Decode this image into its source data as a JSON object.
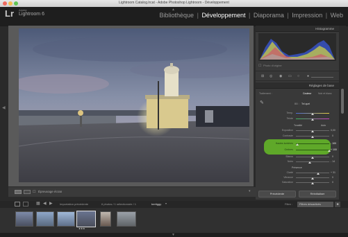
{
  "window": {
    "title": "Lightroom Catalog.lrcat - Adobe Photoshop Lightroom - Développement"
  },
  "identity": {
    "adobe_label": "Adobe",
    "app_name": "Lightroom 6",
    "logo": "Lr"
  },
  "modules": {
    "items": [
      "Bibliothèque",
      "Développement",
      "Diaporama",
      "Impression",
      "Web"
    ],
    "active": "Développement",
    "separator": "|"
  },
  "panel": {
    "histogram_label": "Histogramme",
    "original_photo_label": "Photo d'origine",
    "basic_label": "Réglages de base",
    "treatment_label": "Traitement :",
    "treatment_color": "Couleur",
    "treatment_bw": "Noir et blanc",
    "wb_label": "BB :",
    "wb_value": "Tel quel",
    "temp_label": "Temp.",
    "tint_label": "Teinte",
    "tone_label": "Tonalité",
    "auto_label": "Auto",
    "exposure_label": "Exposition",
    "exposure_value": "0,00",
    "contrast_label": "Contraste",
    "contrast_value": "0",
    "highlights_label": "Hautes lumières",
    "highlights_value": "- 100",
    "shadows_label": "Ombres",
    "shadows_value": "+ 100",
    "whites_label": "Blancs",
    "whites_value": "0",
    "blacks_label": "Noirs",
    "blacks_value": "- 14",
    "presence_label": "Présence",
    "clarity_label": "Clarté",
    "clarity_value": "+ 31",
    "vibrance_label": "Vibrance",
    "vibrance_value": "0",
    "saturation_label": "Saturation",
    "saturation_value": "0",
    "previous_button": "Précédente",
    "reset_button": "Réinitialiser"
  },
  "toolbar": {
    "softproof_label": "Épreuvage écran"
  },
  "filmstrip": {
    "source_label": "Importation précédente",
    "selection_label": "6 photos / 1 sélectionnée / 1",
    "filename": "bertiggy",
    "filter_label": "Filtre :",
    "filter_value": "Filtres désactivés",
    "thumb_rating": "★★★"
  },
  "colors": {
    "accent_green": "#5fa829",
    "active_module": "#ffffff",
    "inactive_module": "#9a9a9a",
    "panel_bg": "#393939"
  }
}
